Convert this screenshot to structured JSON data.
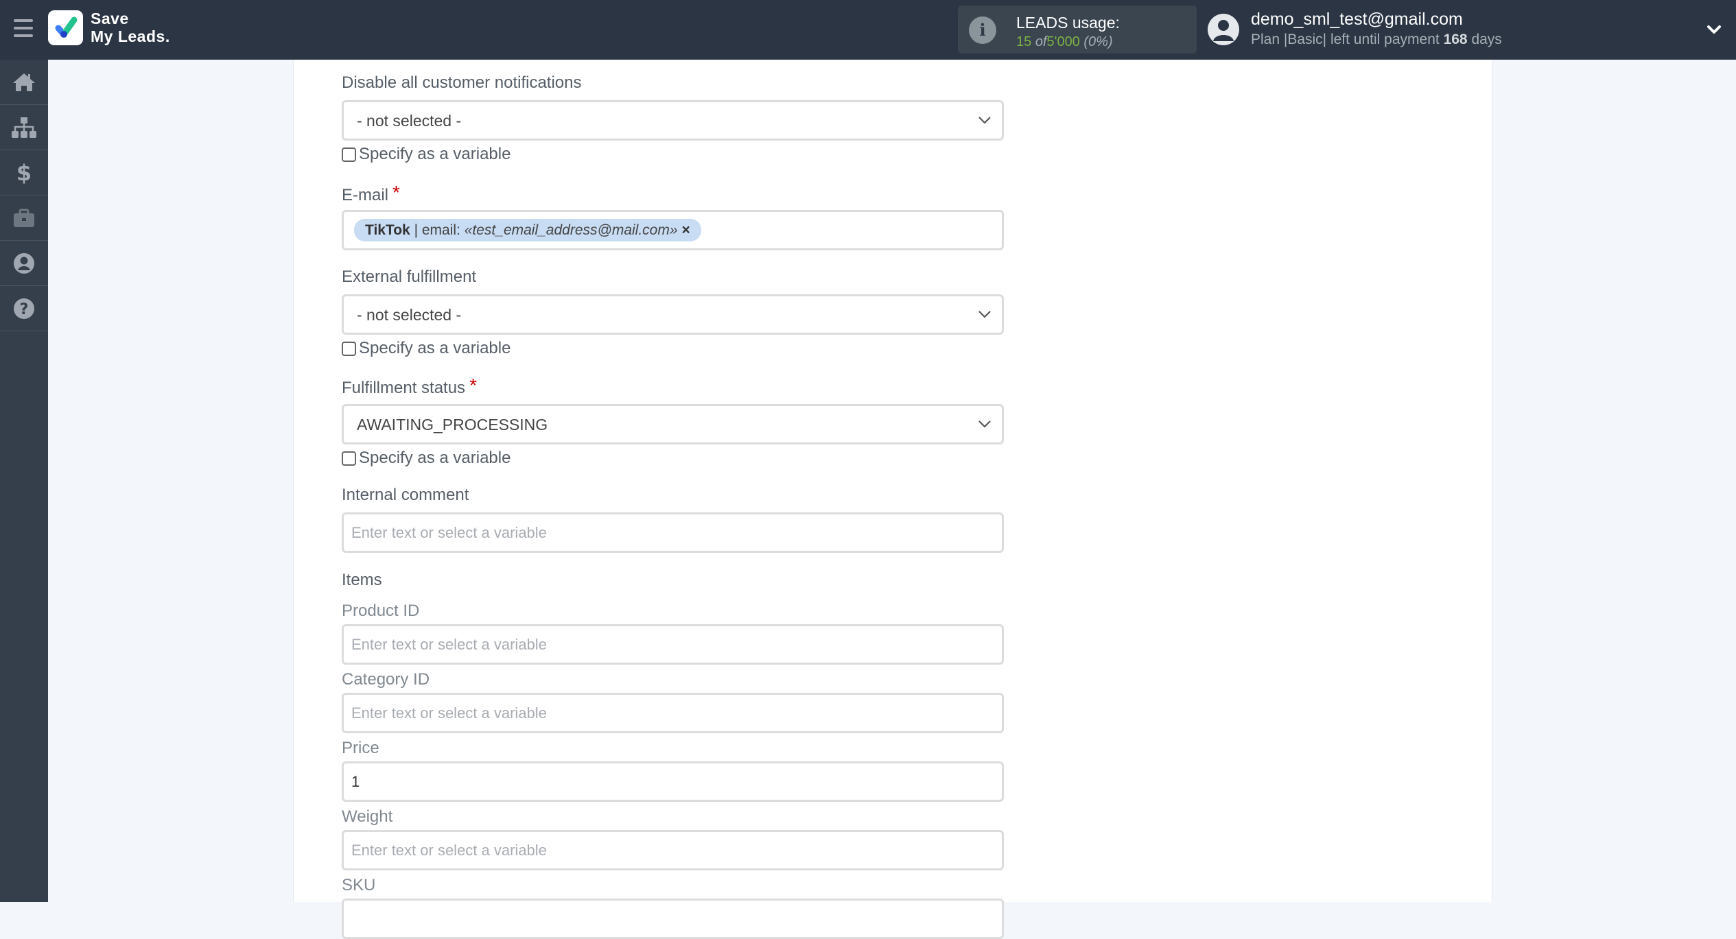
{
  "app": {
    "logo_line1": "Save",
    "logo_line2": "My Leads.",
    "brand_colors": {
      "topbar": "#2b3543",
      "sidebar": "#343f4b",
      "accent_green": "#7cb342",
      "required": "#cc0000"
    }
  },
  "usage": {
    "title": "LEADS usage:",
    "used": "15",
    "of_label": "of",
    "limit": "5'000",
    "percent": "(0%)"
  },
  "user": {
    "email": "demo_sml_test@gmail.com",
    "plan_prefix": "Plan |Basic| left until payment",
    "days": "168",
    "days_suffix": "days"
  },
  "sidebar": {
    "items": [
      {
        "icon": "home-icon"
      },
      {
        "icon": "sitemap-icon"
      },
      {
        "icon": "dollar-icon"
      },
      {
        "icon": "briefcase-icon"
      },
      {
        "icon": "user-circle-icon"
      },
      {
        "icon": "help-icon"
      }
    ]
  },
  "form": {
    "disable_notifications": {
      "label": "Disable all customer notifications",
      "value": "- not selected -",
      "checkbox_label": "Specify as a variable",
      "checked": false
    },
    "email": {
      "label": "E-mail",
      "required": "*",
      "tag": {
        "source": "TikTok",
        "separator": " | email: ",
        "value": "«test_email_address@mail.com»",
        "remove": "×"
      }
    },
    "external_fulfillment": {
      "label": "External fulfillment",
      "value": "- not selected -",
      "checkbox_label": "Specify as a variable",
      "checked": false
    },
    "fulfillment_status": {
      "label": "Fulfillment status",
      "required": "*",
      "value": "AWAITING_PROCESSING",
      "checkbox_label": "Specify as a variable",
      "checked": false
    },
    "internal_comment": {
      "label": "Internal comment",
      "placeholder": "Enter text or select a variable",
      "value": ""
    },
    "items_heading": "Items",
    "product_id": {
      "label": "Product ID",
      "placeholder": "Enter text or select a variable",
      "value": ""
    },
    "category_id": {
      "label": "Category ID",
      "placeholder": "Enter text or select a variable",
      "value": ""
    },
    "price": {
      "label": "Price",
      "placeholder": "Enter text or select a variable",
      "value": "1"
    },
    "weight": {
      "label": "Weight",
      "placeholder": "Enter text or select a variable",
      "value": ""
    },
    "sku": {
      "label": "SKU"
    }
  }
}
